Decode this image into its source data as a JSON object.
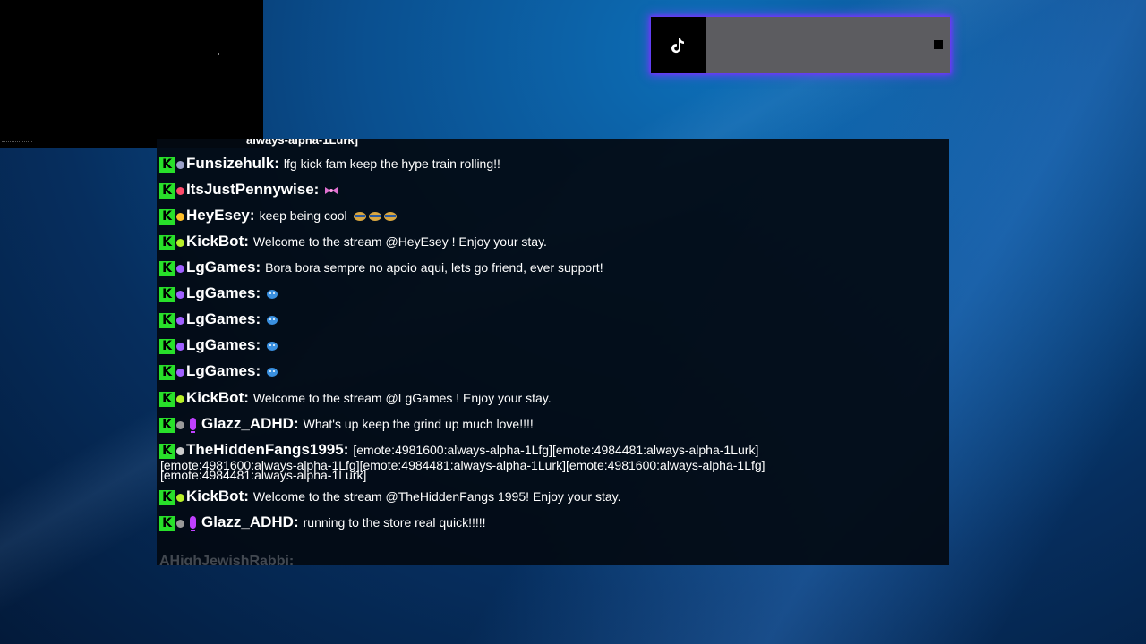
{
  "tiktok_widget": {
    "icon": "tiktok-icon",
    "stop_icon": "stop-square-icon"
  },
  "chat": {
    "partial_top_text": "always-alpha-1Lurk]",
    "messages": [
      {
        "user": "Funsizehulk:",
        "text": "lfg kick fam keep the hype train rolling!!",
        "badge_color": "#9aa0c8"
      },
      {
        "user": "ItsJustPennywise:",
        "text": "",
        "emote": "pink-emote",
        "badge_color": "#ff4a6a"
      },
      {
        "user": "HeyEsey:",
        "text": "keep being cool",
        "emote": "cool-emotes",
        "badge_color": "#ffbf2a"
      },
      {
        "user": "KickBot:",
        "text": "Welcome to the stream @HeyEsey ! Enjoy your stay.",
        "badge_color": "#b8f028"
      },
      {
        "user": "LgGames:",
        "text": "Bora bora sempre no apoio aqui, lets go friend, ever support!",
        "badge_color": "#a060ff"
      },
      {
        "user": "LgGames:",
        "text": "",
        "emote": "blue-emote",
        "badge_color": "#a060ff"
      },
      {
        "user": "LgGames:",
        "text": "",
        "emote": "blue-emote",
        "badge_color": "#a060ff"
      },
      {
        "user": "LgGames:",
        "text": "",
        "emote": "blue-emote",
        "badge_color": "#a060ff"
      },
      {
        "user": "LgGames:",
        "text": "",
        "emote": "blue-emote",
        "badge_color": "#a060ff"
      },
      {
        "user": "KickBot:",
        "text": "Welcome to the stream @LgGames ! Enjoy your stay.",
        "badge_color": "#b8f028"
      },
      {
        "user": "Glazz_ADHD:",
        "text": "What's up keep the grind up much love!!!!",
        "badge_color": "#999999",
        "mic": true
      },
      {
        "user": "TheHiddenFangs1995:",
        "text": "[emote:4981600:always-alpha-1Lfg][emote:4984481:always-alpha-1Lurk]",
        "badge_color": "#cccccc"
      },
      {
        "user": "KickBot:",
        "text": "Welcome to the stream @TheHiddenFangs 1995! Enjoy your stay.",
        "badge_color": "#b8f028"
      },
      {
        "user": "Glazz_ADHD:",
        "text": "running to the store real quick!!!!!",
        "badge_color": "#999999",
        "mic": true
      }
    ],
    "wrap_lines": [
      "[emote:4981600:always-alpha-1Lfg][emote:4984481:always-alpha-1Lurk][emote:4981600:always-alpha-1Lfg]",
      "[emote:4984481:always-alpha-1Lurk]"
    ],
    "faded_user": "AHighJewishRabbi:",
    "kick_badge_letter": "K"
  }
}
